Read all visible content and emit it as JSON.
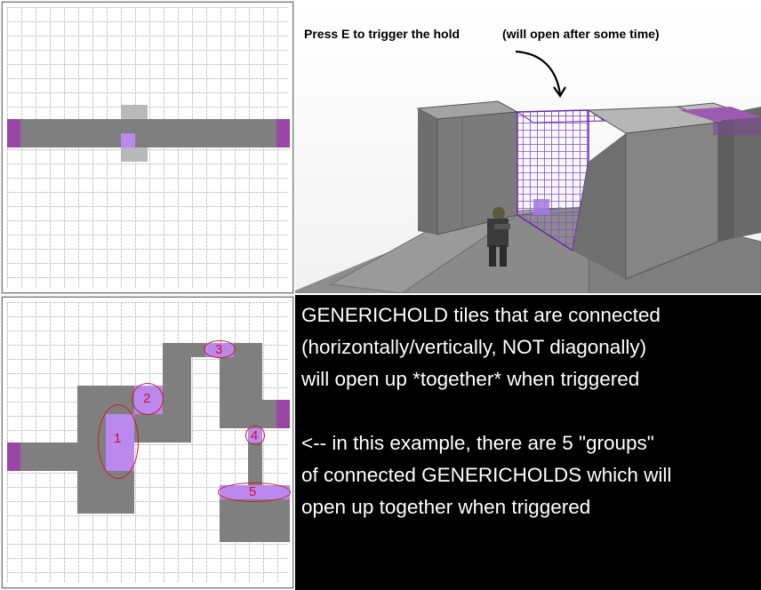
{
  "colors": {
    "tile": "#7f7f7f",
    "tile_light": "#b9b9b9",
    "hold": "#bb88ee",
    "hold_dark": "#9a46a6",
    "marker": "#cc1a2a",
    "text_bg": "#000000",
    "text_fg": "#ffffff"
  },
  "scene": {
    "caption_left": "Press E to trigger the hold",
    "caption_right": "(will open after some time)"
  },
  "explanation": {
    "lines": [
      "GENERICHOLD tiles that are connected",
      "(horizontally/vertically, NOT diagonally)",
      "will open up *together* when triggered",
      "",
      "<--  in this example, there are 5 \"groups\"",
      "of connected GENERICHOLDS which will",
      "open up together when triggered"
    ]
  },
  "group_labels": [
    "1",
    "2",
    "3",
    "4",
    "5"
  ]
}
